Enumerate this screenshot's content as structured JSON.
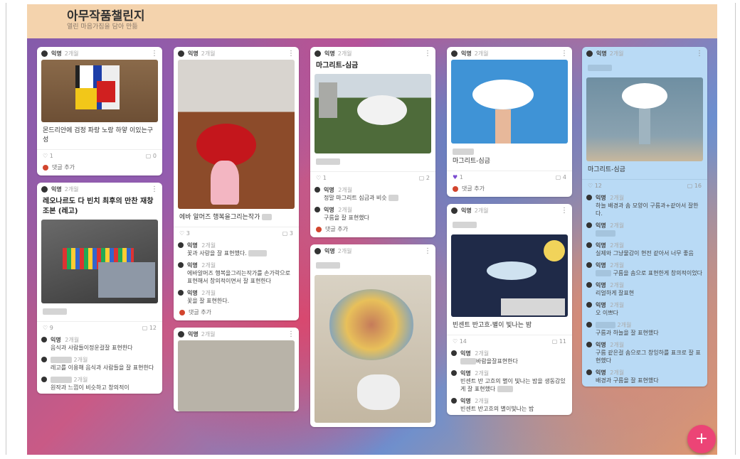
{
  "header": {
    "title": "아무작품챌린지",
    "subtitle": "열린 마음가짐을 담아 만듦"
  },
  "common": {
    "author": "익명",
    "time": "2개월",
    "add_comment": "댓글 추가"
  },
  "cards": {
    "c1": {
      "text": "몬드리안에 검정 파랑 노랑 하얗 이있는구성",
      "likes": "1",
      "comments": "0"
    },
    "c2": {
      "title": "레오나르도 다 빈치 최후의 만찬 재창조본 (레고)",
      "likes": "9",
      "comments": "12",
      "comments_list": [
        "음식과 사람들이정운걸잘 표현한다",
        "레고를 이용해 음식과 사람들을 잘 표현한다",
        "원작과 느낌이 비슷하고 창의적이"
      ]
    },
    "c3": {
      "text": "에바 알머즈 행복을그리는작가",
      "likes": "3",
      "comments": "3",
      "comments_list": [
        "꽃과 사랑을 잘 표현했다.",
        "에바알머즈 행복을그리는작가를 손가락으로 표현해서 창의적이면서 잘 표현한다",
        "꽃을 잘 표현한다."
      ]
    },
    "c4": {
      "title": "마그리트-심금",
      "likes": "1",
      "comments": "2",
      "comments_list": [
        "정말 마그리트 심금과 비슷",
        "구름을 잘 표현했다"
      ]
    },
    "c5": {
      "title": ""
    },
    "c6": {
      "text": "마그리트-심금",
      "likes": "1",
      "comments": "4"
    },
    "c7": {
      "text": "빈센트 반고흐-별이 빛나는 밤",
      "likes": "14",
      "comments": "11",
      "comments_list": [
        "바람을잘표현한다",
        "빈센트 반 고흐의 별이 빛나는 밤을 생동감있게 잘 표현했다",
        "빈센트 반고흐의 별이빛나는 밤"
      ]
    },
    "c8": {
      "text": "마그리트-심금",
      "likes": "12",
      "comments": "16",
      "comments_list": [
        "하늘 배경과 솜 모양이 구름과+같아서 잘한다.",
        "",
        "실제와 그냥물감이 현전 같아서 너무 좋음",
        "구름을 솜으로 표현한게 창의적이었다",
        "리얼하게 잘표현",
        "오 이쁘다",
        "구름과 하늘을 잘 표현했다",
        "구름 같은걸 솜으로그 창잉하를 표크로 잘 표현했다",
        "배경과 구름을 잘 표현했다"
      ]
    }
  },
  "fab_label": "+"
}
